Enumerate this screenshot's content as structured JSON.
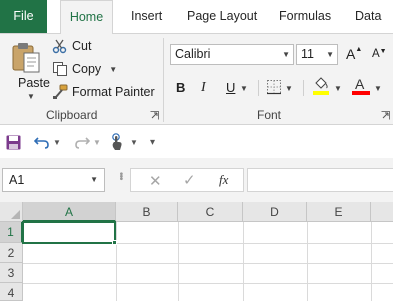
{
  "tabs": {
    "file": "File",
    "home": "Home",
    "insert": "Insert",
    "page_layout": "Page Layout",
    "formulas": "Formulas",
    "data": "Data"
  },
  "clipboard": {
    "paste_label": "Paste",
    "cut_label": "Cut",
    "copy_label": "Copy",
    "format_painter_label": "Format Painter",
    "group_label": "Clipboard"
  },
  "font": {
    "name": "Calibri",
    "size": "11",
    "grow_label": "A",
    "shrink_label": "A",
    "bold_label": "B",
    "italic_label": "I",
    "underline_label": "U",
    "fill_color_hex": "#ffff00",
    "font_color_hex": "#ff0000",
    "font_color_label": "A",
    "group_label": "Font"
  },
  "formula_bar": {
    "name_box": "A1",
    "cancel_glyph": "✕",
    "enter_glyph": "✓",
    "function_label": "fx",
    "formula": ""
  },
  "grid": {
    "columns": [
      "A",
      "B",
      "C",
      "D",
      "E"
    ],
    "rows": [
      "1",
      "2",
      "3",
      "4"
    ],
    "active_cell": "A1"
  },
  "accent_color": "#217346"
}
